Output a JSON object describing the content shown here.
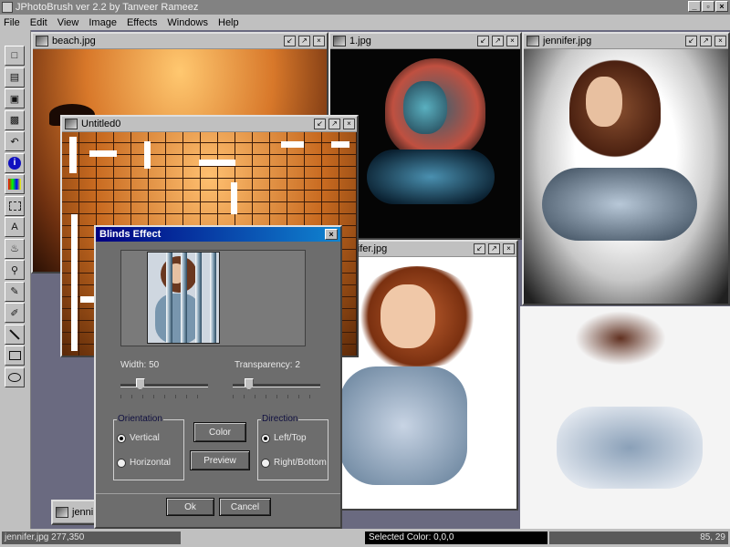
{
  "app": {
    "title": "JPhotoBrush  ver 2.2 by Tanveer Rameez"
  },
  "menu": [
    "File",
    "Edit",
    "View",
    "Image",
    "Effects",
    "Windows",
    "Help"
  ],
  "window_controls": {
    "minimize": "_",
    "maximize": "▫",
    "close": "×"
  },
  "frames": {
    "beach": {
      "title": "beach.jpg"
    },
    "one": {
      "title": "1.jpg"
    },
    "jennifer_top": {
      "title": "jennifer.jpg"
    },
    "untitled": {
      "title": "Untitled0"
    },
    "jennifer_mid": {
      "title": "jennifer.jpg"
    },
    "minimized": {
      "title": "jenni"
    }
  },
  "dialog": {
    "title": "Blinds Effect",
    "width_label": "Width: 50",
    "width_value": 50,
    "transparency_label": "Transparency: 2",
    "transparency_value": 2,
    "orientation": {
      "legend": "Orientation",
      "options": [
        "Vertical",
        "Horizontal"
      ],
      "selected": "Vertical"
    },
    "direction": {
      "legend": "Direction",
      "options": [
        "Left/Top",
        "Right/Bottom"
      ],
      "selected": "Left/Top"
    },
    "color_button": "Color",
    "preview_button": "Preview",
    "ok_button": "Ok",
    "cancel_button": "Cancel"
  },
  "status": {
    "left": "jennifer.jpg  277,350",
    "middle": "Selected  Color: 0,0,0",
    "right": "85, 29"
  },
  "tools": [
    "new-icon",
    "open-icon",
    "save-icon",
    "print-icon",
    "undo-icon",
    "info-icon",
    "palette-icon",
    "select-icon",
    "text-icon",
    "fill-icon",
    "zoom-icon",
    "eyedropper-icon",
    "brush-icon",
    "line-icon",
    "rectangle-icon",
    "ellipse-icon"
  ]
}
